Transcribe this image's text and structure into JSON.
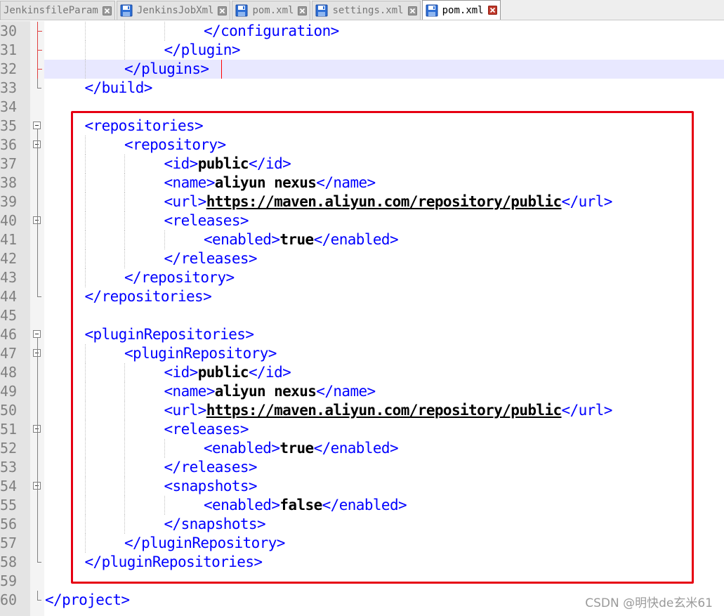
{
  "tabs": [
    {
      "label": "JenkinsfileParam",
      "active": false,
      "disk_icon": "none"
    },
    {
      "label": "JenkinsJobXml",
      "active": false,
      "disk_icon": "save-icon"
    },
    {
      "label": "pom.xml",
      "active": false,
      "disk_icon": "save-icon"
    },
    {
      "label": "settings.xml",
      "active": false,
      "disk_icon": "save-icon"
    },
    {
      "label": "pom.xml",
      "active": true,
      "disk_icon": "save-icon"
    }
  ],
  "editor": {
    "current_line": "32",
    "lines": [
      {
        "num": "30",
        "indent": 4,
        "parts": [
          {
            "t": "tag",
            "v": "</configuration>"
          }
        ]
      },
      {
        "num": "31",
        "indent": 3,
        "parts": [
          {
            "t": "tag",
            "v": "</plugin>"
          }
        ]
      },
      {
        "num": "32",
        "indent": 2,
        "parts": [
          {
            "t": "tag",
            "v": "</plugins>"
          }
        ]
      },
      {
        "num": "33",
        "indent": 1,
        "parts": [
          {
            "t": "tag",
            "v": "</build>"
          }
        ]
      },
      {
        "num": "34",
        "indent": 0,
        "parts": []
      },
      {
        "num": "35",
        "indent": 1,
        "parts": [
          {
            "t": "tag",
            "v": "<repositories>"
          }
        ]
      },
      {
        "num": "36",
        "indent": 2,
        "parts": [
          {
            "t": "tag",
            "v": "<repository>"
          }
        ]
      },
      {
        "num": "37",
        "indent": 3,
        "parts": [
          {
            "t": "tag",
            "v": "<id>"
          },
          {
            "t": "txt",
            "v": "public"
          },
          {
            "t": "tag",
            "v": "</id>"
          }
        ]
      },
      {
        "num": "38",
        "indent": 3,
        "parts": [
          {
            "t": "tag",
            "v": "<name>"
          },
          {
            "t": "txt",
            "v": "aliyun nexus"
          },
          {
            "t": "tag",
            "v": "</name>"
          }
        ]
      },
      {
        "num": "39",
        "indent": 3,
        "parts": [
          {
            "t": "tag",
            "v": "<url>"
          },
          {
            "t": "url",
            "v": "https://maven.aliyun.com/repository/public"
          },
          {
            "t": "tag",
            "v": "</url>"
          }
        ]
      },
      {
        "num": "40",
        "indent": 3,
        "parts": [
          {
            "t": "tag",
            "v": "<releases>"
          }
        ]
      },
      {
        "num": "41",
        "indent": 4,
        "parts": [
          {
            "t": "tag",
            "v": "<enabled>"
          },
          {
            "t": "txt",
            "v": "true"
          },
          {
            "t": "tag",
            "v": "</enabled>"
          }
        ]
      },
      {
        "num": "42",
        "indent": 3,
        "parts": [
          {
            "t": "tag",
            "v": "</releases>"
          }
        ]
      },
      {
        "num": "43",
        "indent": 2,
        "parts": [
          {
            "t": "tag",
            "v": "</repository>"
          }
        ]
      },
      {
        "num": "44",
        "indent": 1,
        "parts": [
          {
            "t": "tag",
            "v": "</repositories>"
          }
        ]
      },
      {
        "num": "45",
        "indent": 0,
        "parts": []
      },
      {
        "num": "46",
        "indent": 1,
        "parts": [
          {
            "t": "tag",
            "v": "<pluginRepositories>"
          }
        ]
      },
      {
        "num": "47",
        "indent": 2,
        "parts": [
          {
            "t": "tag",
            "v": "<pluginRepository>"
          }
        ]
      },
      {
        "num": "48",
        "indent": 3,
        "parts": [
          {
            "t": "tag",
            "v": "<id>"
          },
          {
            "t": "txt",
            "v": "public"
          },
          {
            "t": "tag",
            "v": "</id>"
          }
        ]
      },
      {
        "num": "49",
        "indent": 3,
        "parts": [
          {
            "t": "tag",
            "v": "<name>"
          },
          {
            "t": "txt",
            "v": "aliyun nexus"
          },
          {
            "t": "tag",
            "v": "</name>"
          }
        ]
      },
      {
        "num": "50",
        "indent": 3,
        "parts": [
          {
            "t": "tag",
            "v": "<url>"
          },
          {
            "t": "url",
            "v": "https://maven.aliyun.com/repository/public"
          },
          {
            "t": "tag",
            "v": "</url>"
          }
        ]
      },
      {
        "num": "51",
        "indent": 3,
        "parts": [
          {
            "t": "tag",
            "v": "<releases>"
          }
        ]
      },
      {
        "num": "52",
        "indent": 4,
        "parts": [
          {
            "t": "tag",
            "v": "<enabled>"
          },
          {
            "t": "txt",
            "v": "true"
          },
          {
            "t": "tag",
            "v": "</enabled>"
          }
        ]
      },
      {
        "num": "53",
        "indent": 3,
        "parts": [
          {
            "t": "tag",
            "v": "</releases>"
          }
        ]
      },
      {
        "num": "54",
        "indent": 3,
        "parts": [
          {
            "t": "tag",
            "v": "<snapshots>"
          }
        ]
      },
      {
        "num": "55",
        "indent": 4,
        "parts": [
          {
            "t": "tag",
            "v": "<enabled>"
          },
          {
            "t": "txt",
            "v": "false"
          },
          {
            "t": "tag",
            "v": "</enabled>"
          }
        ]
      },
      {
        "num": "56",
        "indent": 3,
        "parts": [
          {
            "t": "tag",
            "v": "</snapshots>"
          }
        ]
      },
      {
        "num": "57",
        "indent": 2,
        "parts": [
          {
            "t": "tag",
            "v": "</pluginRepository>"
          }
        ]
      },
      {
        "num": "58",
        "indent": 1,
        "parts": [
          {
            "t": "tag",
            "v": "</pluginRepositories>"
          }
        ]
      },
      {
        "num": "59",
        "indent": 0,
        "parts": []
      },
      {
        "num": "60",
        "indent": 0,
        "parts": [
          {
            "t": "tag",
            "v": "</project>"
          }
        ]
      }
    ],
    "fold_markers": [
      "35",
      "36",
      "40",
      "46",
      "47",
      "51",
      "54"
    ]
  },
  "watermark": "CSDN @明快de玄米61",
  "colors": {
    "tag": "#0000ff",
    "text": "#000000",
    "highlight_box": "#e60012",
    "current_line_bg": "#e8e8ff"
  }
}
